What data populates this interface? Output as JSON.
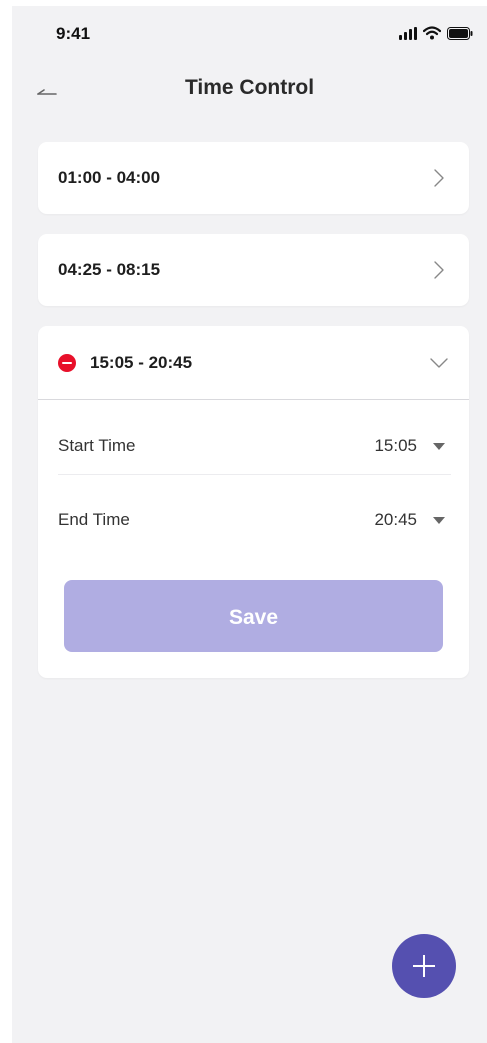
{
  "status_bar": {
    "time": "9:41"
  },
  "header": {
    "title": "Time Control"
  },
  "schedules": [
    {
      "range": "01:00 - 04:00"
    },
    {
      "range": "04:25 - 08:15"
    }
  ],
  "expanded": {
    "range": "15:05 - 20:45",
    "start_label": "Start Time",
    "start_value": "15:05",
    "end_label": "End Time",
    "end_value": "20:45",
    "save_label": "Save"
  },
  "colors": {
    "accent": "#5550b0",
    "save_disabled": "#b0ade2",
    "remove": "#e8102a",
    "background": "#f2f2f4"
  },
  "icons": [
    "back-arrow-icon",
    "chevron-right-icon",
    "chevron-down-icon",
    "remove-icon",
    "caret-down-icon",
    "plus-icon",
    "signal-icon",
    "wifi-icon",
    "battery-icon"
  ]
}
